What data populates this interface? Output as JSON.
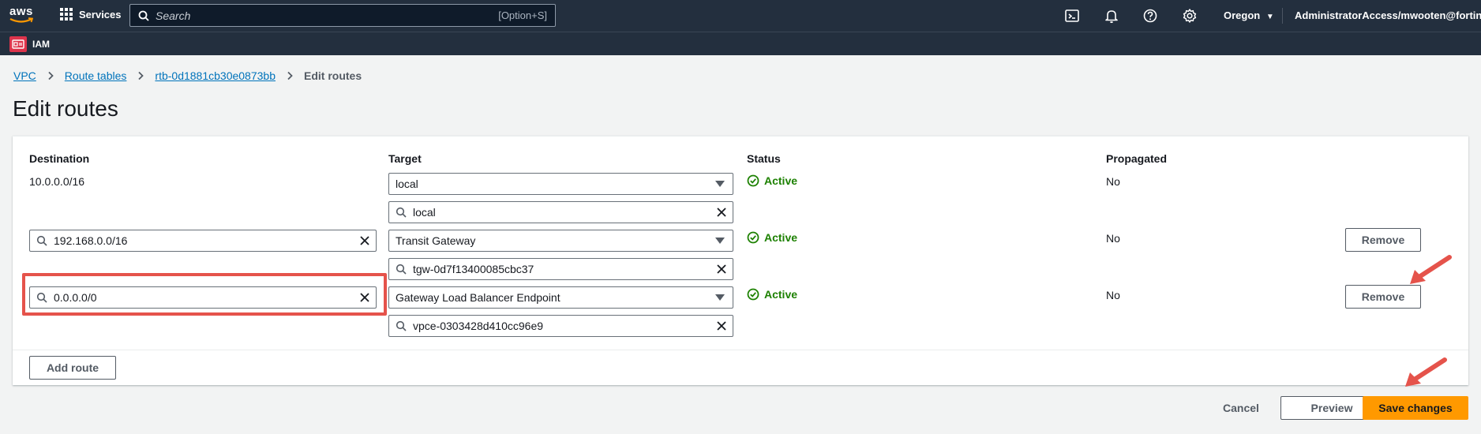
{
  "nav": {
    "logo_text": "aws",
    "services_label": "Services",
    "search_placeholder": "Search",
    "search_shortcut": "[Option+S]",
    "region": "Oregon",
    "account": "AdministratorAccess/mwooten@fortinet.com",
    "icons": [
      "cloudshell-icon",
      "bell-icon",
      "help-icon",
      "gear-icon"
    ]
  },
  "service_bar": {
    "label": "IAM"
  },
  "breadcrumb": {
    "items": [
      "VPC",
      "Route tables",
      "rtb-0d1881cb30e0873bb"
    ],
    "current": "Edit routes"
  },
  "page_title": "Edit routes",
  "table": {
    "headers": {
      "destination": "Destination",
      "target": "Target",
      "status": "Status",
      "propagated": "Propagated"
    },
    "rows": [
      {
        "destination": "10.0.0.0/16",
        "target_type": "local",
        "target_id": "local",
        "status": "Active",
        "propagated": "No",
        "removable": false
      },
      {
        "destination": "192.168.0.0/16",
        "target_type": "Transit Gateway",
        "target_id": "tgw-0d7f13400085cbc37",
        "status": "Active",
        "propagated": "No",
        "removable": true
      },
      {
        "destination": "0.0.0.0/0",
        "target_type": "Gateway Load Balancer Endpoint",
        "target_id": "vpce-0303428d410cc96e9",
        "status": "Active",
        "propagated": "No",
        "removable": true
      }
    ],
    "remove_label": "Remove",
    "add_route_label": "Add route"
  },
  "footer": {
    "cancel_label": "Cancel",
    "preview_label": "Preview",
    "save_label": "Save changes"
  },
  "colors": {
    "nav_bg": "#232f3e",
    "link": "#0073bb",
    "active": "#1d8102",
    "primary": "#ff9900",
    "annotation": "#e5534b"
  }
}
